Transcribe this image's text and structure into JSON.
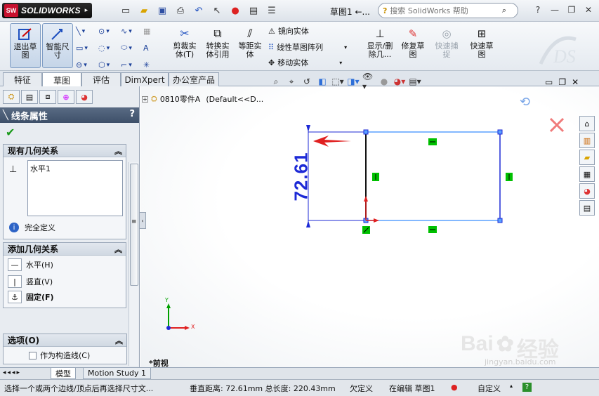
{
  "app": {
    "logo_badge": "SW",
    "logo_text": "SOLIDWORKS",
    "doc_title": "草图1 ←...",
    "search_placeholder": "搜索 SolidWorks 帮助"
  },
  "commands": {
    "exit_sketch": "退出草图",
    "smart_dim": "智能尺寸",
    "trim": "剪裁实体(T)",
    "convert": "转换实体引用",
    "offset": "等距实体",
    "mirror": "镜向实体",
    "linear_pattern": "线性草图阵列",
    "move": "移动实体",
    "display_delete": "显示/删除几...",
    "repair": "修复草图",
    "quick_snap": "快速捕捉",
    "rapid_sketch": "快速草图"
  },
  "tabs": [
    "特征",
    "草图",
    "评估",
    "DimXpert",
    "办公室产品"
  ],
  "active_tab": 1,
  "tree": {
    "part_name": "0810零件A",
    "config": "(Default<<D..."
  },
  "property_manager": {
    "title": "线条属性",
    "help": "?",
    "existing_relations": {
      "header": "现有几何关系",
      "items": [
        "水平1"
      ],
      "status": "完全定义"
    },
    "add_relations": {
      "header": "添加几何关系",
      "horizontal": "水平(H)",
      "vertical": "竖直(V)",
      "fix": "固定(F)"
    },
    "options": {
      "header": "选项(O)",
      "construction": "作为构造线(C)"
    }
  },
  "graphics": {
    "dimension": "72.61",
    "view_label": "*前视",
    "axis_x": "X",
    "axis_y": "Y"
  },
  "bottom_tabs": [
    "模型",
    "Motion Study 1"
  ],
  "status": {
    "hint": "选择一个或两个边线/顶点后再选择尺寸文...",
    "measure": "垂直距离: 72.61mm 总长度: 220.43mm",
    "state": "欠定义",
    "editing": "在编辑 草图1",
    "units": "自定义",
    "help": "?"
  },
  "watermark": {
    "brand": "Bai",
    "brand2": "经验",
    "url": "jingyan.baidu.com"
  },
  "colors": {
    "sketch_blue": "#1d2ad6",
    "selected_line": "#5aa0ff",
    "relation_green": "#00c000",
    "arrow_red": "#e02020"
  }
}
